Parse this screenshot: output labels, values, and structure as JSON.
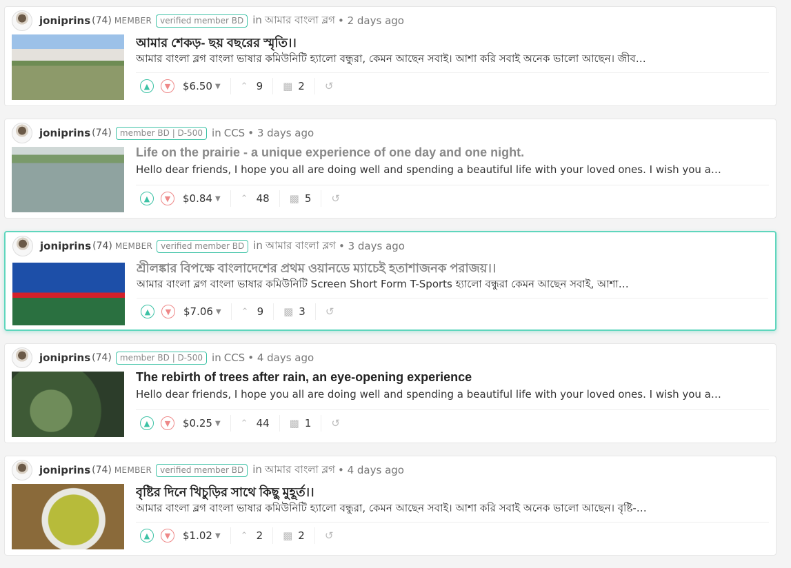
{
  "posts": [
    {
      "author": "joniprins",
      "reputation": "(74)",
      "role": "MEMBER",
      "badge": "verified member BD",
      "in_label": "in",
      "community": "আমার বাংলা ব্লগ",
      "time": "• 2 days ago",
      "title": "আমার শেকড়- ছয় বছরের স্মৃতি।।",
      "excerpt": "আমার বাংলা ব্লগ বাংলা ভাষার কমিউনিটি হ্যালো বন্ধুরা, কেমন আছেন সবাই। আশা করি সবাই অনেক ভালো আছেন। জীব…",
      "payout": "$6.50",
      "votes": "9",
      "comments": "2"
    },
    {
      "author": "joniprins",
      "reputation": "(74)",
      "role": "",
      "badge": "member BD | D-500",
      "in_label": "in",
      "community": "CCS",
      "time": "• 3 days ago",
      "title": "Life on the prairie - a unique experience of one day and one night.",
      "excerpt": "Hello dear friends, I hope you all are doing well and spending a beautiful life with your loved ones. I wish you all…",
      "payout": "$0.84",
      "votes": "48",
      "comments": "5"
    },
    {
      "author": "joniprins",
      "reputation": "(74)",
      "role": "MEMBER",
      "badge": "verified member BD",
      "in_label": "in",
      "community": "আমার বাংলা ব্লগ",
      "time": "• 3 days ago",
      "title": "শ্রীলঙ্কার বিপক্ষে বাংলাদেশের প্রথম ওয়ানডে ম্যাচেই হতাশাজনক পরাজয়।।",
      "excerpt": "আমার বাংলা ব্লগ বাংলা ভাষার কমিউনিটি Screen Short Form T-Sports হ্যালো বন্ধুরা কেমন আছেন সবাই, আশা…",
      "payout": "$7.06",
      "votes": "9",
      "comments": "3"
    },
    {
      "author": "joniprins",
      "reputation": "(74)",
      "role": "",
      "badge": "member BD | D-500",
      "in_label": "in",
      "community": "CCS",
      "time": "• 4 days ago",
      "title": "The rebirth of trees after rain, an eye-opening experience",
      "excerpt": "Hello dear friends, I hope you all are doing well and spending a beautiful life with your loved ones. I wish you all…",
      "payout": "$0.25",
      "votes": "44",
      "comments": "1"
    },
    {
      "author": "joniprins",
      "reputation": "(74)",
      "role": "MEMBER",
      "badge": "verified member BD",
      "in_label": "in",
      "community": "আমার বাংলা ব্লগ",
      "time": "• 4 days ago",
      "title": "বৃষ্টির দিনে খিচুড়ির সাথে কিছু মুহূর্ত।।",
      "excerpt": "আমার বাংলা ব্লগ বাংলা ভাষার কমিউনিটি হ্যালো বন্ধুরা, কেমন আছেন সবাই। আশা করি সবাই অনেক ভালো আছেন। বৃষ্টি-…",
      "payout": "$1.02",
      "votes": "2",
      "comments": "2"
    }
  ],
  "colors": {
    "accent": "#3cc2a5",
    "downvote": "#e88888",
    "highlight_border": "#5fd6bd"
  },
  "icons": {
    "upvote": "chevron-up-circle-icon",
    "downvote": "chevron-down-circle-icon",
    "votes": "chevron-up-icon",
    "comments": "comments-icon",
    "resteem": "resteem-icon"
  }
}
